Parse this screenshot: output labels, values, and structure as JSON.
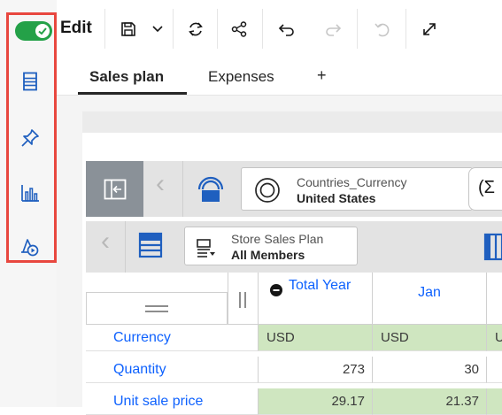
{
  "toolbar": {
    "edit_label": "Edit",
    "toggle_on": true
  },
  "tabs": [
    {
      "label": "Sales plan",
      "active": true
    },
    {
      "label": "Expenses",
      "active": false
    }
  ],
  "add_tab_label": "+",
  "dimensions": {
    "row1": {
      "label": "Countries_Currency",
      "value": "United States",
      "cut_label": "(Σ"
    },
    "row2": {
      "label": "Store Sales Plan",
      "value": "All Members"
    }
  },
  "grid": {
    "columns": [
      {
        "label": "Total Year",
        "has_collapse_icon": true
      },
      {
        "label": "Jan"
      }
    ],
    "rows": [
      {
        "label": "Currency",
        "cells": [
          "USD",
          "USD",
          "U"
        ]
      },
      {
        "label": "Quantity",
        "cells": [
          "273",
          "30",
          ""
        ]
      },
      {
        "label": "Unit sale price",
        "cells": [
          "29.17",
          "21.37",
          ""
        ]
      }
    ]
  },
  "colors": {
    "toggle_on": "#24a148",
    "highlight_border": "#e8473f",
    "link_blue": "#0f62fe",
    "cell_green": "#cfe6c0",
    "collapse_button": "#8a9198"
  }
}
